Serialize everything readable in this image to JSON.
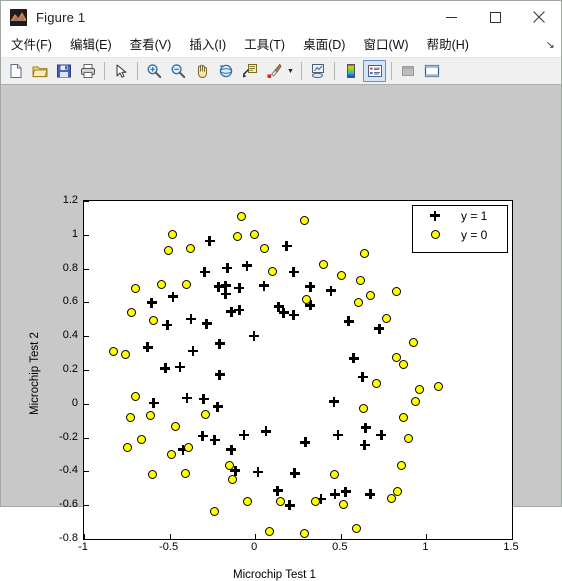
{
  "window": {
    "title": "Figure 1",
    "app_icon": "matlab-membrane-icon",
    "controls": {
      "minimize": "minimize-icon",
      "maximize": "maximize-icon",
      "close": "close-icon"
    }
  },
  "menubar": {
    "items": [
      {
        "label": "文件(F)",
        "name": "menu-file"
      },
      {
        "label": "编辑(E)",
        "name": "menu-edit"
      },
      {
        "label": "查看(V)",
        "name": "menu-view"
      },
      {
        "label": "插入(I)",
        "name": "menu-insert"
      },
      {
        "label": "工具(T)",
        "name": "menu-tools"
      },
      {
        "label": "桌面(D)",
        "name": "menu-desktop"
      },
      {
        "label": "窗口(W)",
        "name": "menu-window"
      },
      {
        "label": "帮助(H)",
        "name": "menu-help"
      }
    ],
    "overflow": "↘"
  },
  "toolbar": {
    "buttons": [
      {
        "name": "new-figure-icon",
        "active": false
      },
      {
        "name": "open-file-icon",
        "active": false
      },
      {
        "name": "save-figure-icon",
        "active": false
      },
      {
        "name": "print-figure-icon",
        "active": false
      },
      {
        "name": "pointer-icon",
        "active": false
      },
      {
        "name": "zoom-in-icon",
        "active": false
      },
      {
        "name": "zoom-out-icon",
        "active": false
      },
      {
        "name": "pan-hand-icon",
        "active": false
      },
      {
        "name": "rotate-3d-icon",
        "active": false
      },
      {
        "name": "data-cursor-icon",
        "active": false
      },
      {
        "name": "brush-select-icon",
        "active": false
      },
      {
        "name": "link-plot-icon",
        "active": false
      },
      {
        "name": "colorbar-icon",
        "active": false
      },
      {
        "name": "legend-icon",
        "active": true
      },
      {
        "name": "hide-plot-tools-icon",
        "active": false
      },
      {
        "name": "show-plot-tools-icon",
        "active": false
      }
    ]
  },
  "colors": {
    "figure_background": "#c8c8c8",
    "axes_background": "#ffffff",
    "marker_y0_face": "#ffff00",
    "marker_y0_edge": "#000000",
    "marker_y1": "#000000",
    "toolbar_background": "#f0f0f0"
  },
  "chart_data": {
    "type": "scatter",
    "title": "",
    "xlabel": "Microchip Test 1",
    "ylabel": "Microchip Test 2",
    "xlim": [
      -1,
      1.5
    ],
    "ylim": [
      -0.8,
      1.2
    ],
    "xticks": [
      -1,
      -0.5,
      0,
      0.5,
      1,
      1.5
    ],
    "xticklabels": [
      "-1",
      "-0.5",
      "0",
      "0.5",
      "1",
      "1.5"
    ],
    "yticks": [
      -0.8,
      -0.6,
      -0.4,
      -0.2,
      0,
      0.2,
      0.4,
      0.6,
      0.8,
      1,
      1.2
    ],
    "yticklabels": [
      "-0.8",
      "-0.6",
      "-0.4",
      "-0.2",
      "0",
      "0.2",
      "0.4",
      "0.6",
      "0.8",
      "1",
      "1.2"
    ],
    "grid": false,
    "legend": {
      "position": "upper right",
      "entries": [
        "y = 1",
        "y = 0"
      ]
    },
    "series": [
      {
        "name": "y = 1",
        "marker": "plus",
        "color": "#000000",
        "points": [
          [
            0.051267,
            0.69956
          ],
          [
            -0.092742,
            0.68494
          ],
          [
            -0.21371,
            0.69225
          ],
          [
            -0.375,
            0.50219
          ],
          [
            -0.51325,
            0.46564
          ],
          [
            -0.52477,
            0.2098
          ],
          [
            -0.39804,
            0.034357
          ],
          [
            -0.30588,
            -0.19225
          ],
          [
            0.016705,
            -0.40424
          ],
          [
            0.13191,
            -0.51389
          ],
          [
            0.38537,
            -0.56506
          ],
          [
            0.52938,
            -0.5212
          ],
          [
            0.63882,
            -0.24342
          ],
          [
            0.73675,
            -0.18494
          ],
          [
            0.54666,
            0.48757
          ],
          [
            0.322,
            0.5826
          ],
          [
            0.16647,
            0.53874
          ],
          [
            -0.046659,
            0.81652
          ],
          [
            -0.17339,
            0.69956
          ],
          [
            -0.47869,
            0.63377
          ],
          [
            -0.60541,
            0.59722
          ],
          [
            -0.62846,
            0.33406
          ],
          [
            -0.59389,
            0.005117
          ],
          [
            -0.42108,
            -0.27266
          ],
          [
            -0.11578,
            -0.39693
          ],
          [
            0.20104,
            -0.60161
          ],
          [
            0.46601,
            -0.53582
          ],
          [
            0.67339,
            -0.53582
          ],
          [
            -0.13882,
            0.54605
          ],
          [
            -0.29435,
            0.77997
          ],
          [
            -0.26555,
            0.96272
          ],
          [
            -0.16187,
            0.8019
          ],
          [
            -0.17339,
            0.64839
          ],
          [
            -0.28283,
            0.47295
          ],
          [
            -0.36348,
            0.31213
          ],
          [
            -0.30012,
            0.027047
          ],
          [
            -0.23675,
            -0.21418
          ],
          [
            -0.06394,
            -0.18494
          ],
          [
            0.062788,
            -0.16301
          ],
          [
            0.22984,
            -0.41155
          ],
          [
            0.2932,
            -0.2288
          ],
          [
            0.48329,
            -0.18494
          ],
          [
            0.64459,
            -0.14108
          ],
          [
            0.46025,
            0.012427
          ],
          [
            0.6273,
            0.15863
          ],
          [
            0.57546,
            0.26827
          ],
          [
            0.72523,
            0.44371
          ],
          [
            0.22408,
            0.52412
          ],
          [
            0.44297,
            0.67032
          ],
          [
            0.322,
            0.69225
          ],
          [
            0.13767,
            0.57529
          ],
          [
            -0.0063364,
            0.39985
          ],
          [
            -0.092742,
            0.55336
          ],
          [
            -0.20795,
            0.35599
          ],
          [
            -0.20795,
            0.17325
          ],
          [
            -0.43836,
            0.21711
          ],
          [
            -0.21947,
            -0.016813
          ],
          [
            -0.13882,
            -0.27266
          ],
          [
            0.18376,
            0.93348
          ],
          [
            0.22408,
            0.77997
          ]
        ]
      },
      {
        "name": "y = 0",
        "marker": "circle",
        "face_color": "#ffff00",
        "edge_color": "#000000",
        "points": [
          [
            0.29896,
            0.61915
          ],
          [
            0.50634,
            0.75804
          ],
          [
            0.61578,
            0.7288
          ],
          [
            0.60426,
            0.59722
          ],
          [
            0.76555,
            0.50219
          ],
          [
            0.92684,
            0.3633
          ],
          [
            0.82316,
            0.27558
          ],
          [
            0.96141,
            0.085526
          ],
          [
            0.93836,
            0.012427
          ],
          [
            0.86348,
            -0.082602
          ],
          [
            0.89804,
            -0.20687
          ],
          [
            0.85196,
            -0.36769
          ],
          [
            0.82892,
            -0.5212
          ],
          [
            0.79435,
            -0.55775
          ],
          [
            0.59274,
            -0.7405
          ],
          [
            0.51786,
            -0.5943
          ],
          [
            0.46601,
            -0.41886
          ],
          [
            0.35081,
            -0.57968
          ],
          [
            0.28744,
            -0.76974
          ],
          [
            0.085829,
            -0.75512
          ],
          [
            0.14919,
            -0.57968
          ],
          [
            -0.13306,
            -0.4481
          ],
          [
            -0.40956,
            -0.41155
          ],
          [
            -0.39228,
            -0.25804
          ],
          [
            -0.74366,
            -0.25804
          ],
          [
            -0.69758,
            0.041667
          ],
          [
            -0.75518,
            0.2902
          ],
          [
            -0.69758,
            0.68494
          ],
          [
            -0.4038,
            0.70687
          ],
          [
            -0.38076,
            0.91886
          ],
          [
            -0.50749,
            0.90424
          ],
          [
            -0.54781,
            0.70687
          ],
          [
            0.10311,
            0.77997
          ],
          [
            0.057028,
            0.91886
          ],
          [
            -0.10426,
            0.99196
          ],
          [
            -0.081221,
            1.1089
          ],
          [
            0.28744,
            1.087
          ],
          [
            0.39689,
            0.82383
          ],
          [
            0.63882,
            0.88962
          ],
          [
            0.82316,
            0.66301
          ],
          [
            0.67339,
            0.64108
          ],
          [
            1.0709,
            0.10015
          ],
          [
            -0.046659,
            -0.57968
          ],
          [
            -0.23675,
            -0.63816
          ],
          [
            -0.15035,
            -0.36769
          ],
          [
            -0.49021,
            -0.3019
          ],
          [
            -0.46717,
            -0.13377
          ],
          [
            -0.28859,
            -0.060673
          ],
          [
            -0.61118,
            -0.067982
          ],
          [
            -0.66302,
            -0.21418
          ],
          [
            -0.59965,
            -0.41886
          ],
          [
            -0.72638,
            -0.082602
          ],
          [
            -0.83007,
            0.31213
          ],
          [
            -0.72062,
            0.53874
          ],
          [
            -0.59389,
            0.49488
          ],
          [
            -0.48445,
            0.99927
          ],
          [
            -0.0063364,
            0.99927
          ],
          [
            0.63265,
            -0.030612
          ],
          [
            0.70975,
            0.12303
          ],
          [
            0.86459,
            0.23316
          ]
        ]
      }
    ]
  }
}
